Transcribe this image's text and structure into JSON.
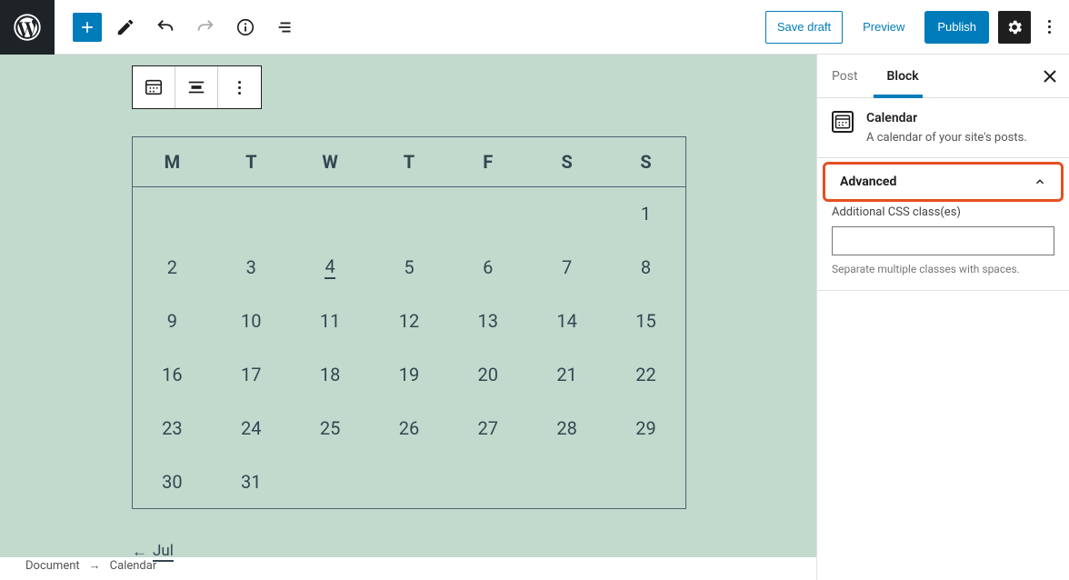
{
  "topbar": {
    "save_draft": "Save draft",
    "preview": "Preview",
    "publish": "Publish"
  },
  "calendar": {
    "weekdays": [
      "M",
      "T",
      "W",
      "T",
      "F",
      "S",
      "S"
    ],
    "weeks": [
      [
        "",
        "",
        "",
        "",
        "",
        "",
        "1"
      ],
      [
        "2",
        "3",
        "4",
        "5",
        "6",
        "7",
        "8"
      ],
      [
        "9",
        "10",
        "11",
        "12",
        "13",
        "14",
        "15"
      ],
      [
        "16",
        "17",
        "18",
        "19",
        "20",
        "21",
        "22"
      ],
      [
        "23",
        "24",
        "25",
        "26",
        "27",
        "28",
        "29"
      ],
      [
        "30",
        "31",
        "",
        "",
        "",
        "",
        ""
      ]
    ],
    "today": "4",
    "prev_month": "Jul",
    "prev_arrow": "←"
  },
  "breadcrumb": {
    "root": "Document",
    "sep": "→",
    "current": "Calendar"
  },
  "sidebar": {
    "tabs": {
      "post": "Post",
      "block": "Block"
    },
    "block_name": "Calendar",
    "block_desc": "A calendar of your site's posts.",
    "advanced_label": "Advanced",
    "css_label": "Additional CSS class(es)",
    "css_value": "",
    "css_help": "Separate multiple classes with spaces."
  }
}
